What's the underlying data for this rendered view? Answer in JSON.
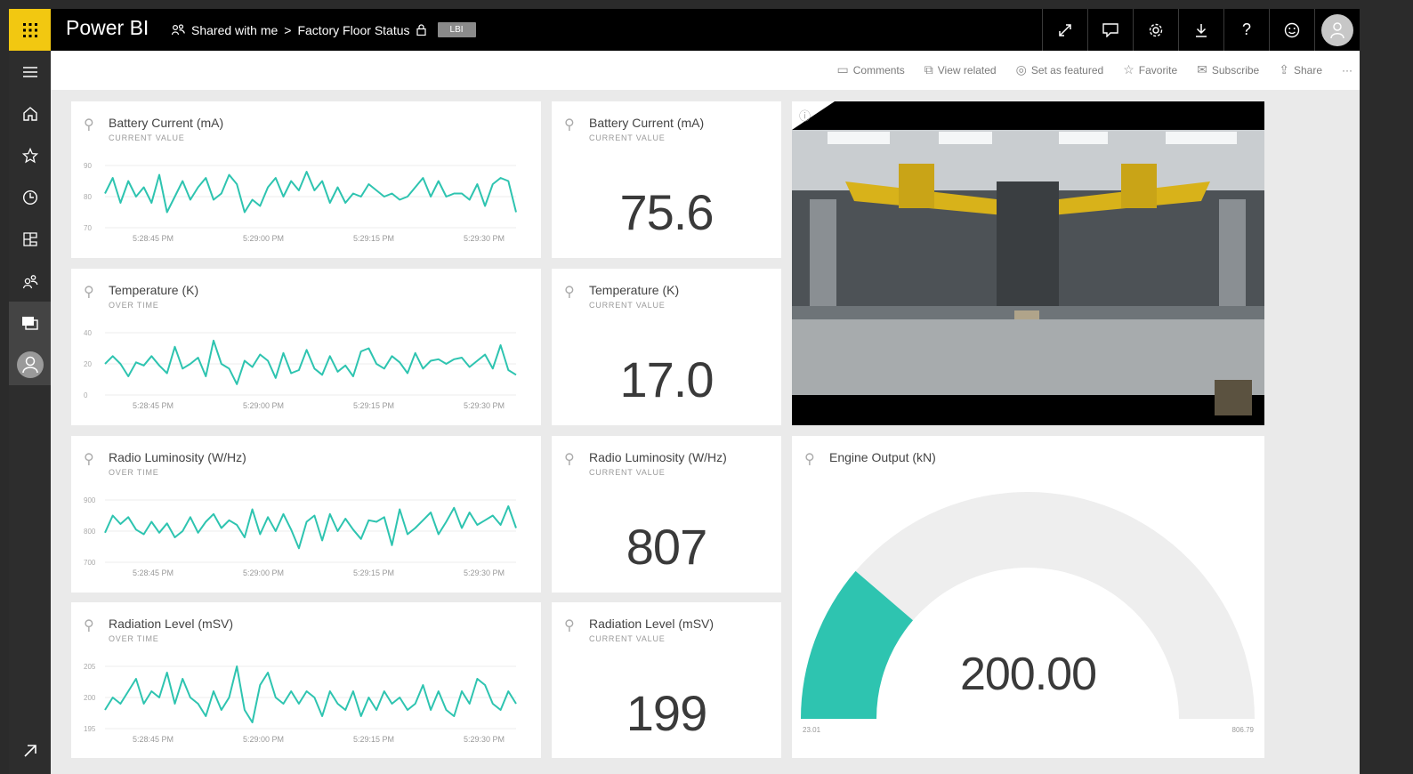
{
  "app": {
    "brand": "Power BI"
  },
  "breadcrumb": {
    "shared": "Shared with me",
    "separator": ">",
    "dashboard": "Factory Floor Status",
    "badge": "LBI"
  },
  "toolbar_icons": [
    "expand-icon",
    "comment-icon",
    "gear-icon",
    "download-icon",
    "help-icon",
    "smiley-icon",
    "user-avatar"
  ],
  "actions": [
    {
      "label": "Comments",
      "icon": "comment-icon"
    },
    {
      "label": "View related",
      "icon": "related-icon"
    },
    {
      "label": "Set as featured",
      "icon": "featured-icon"
    },
    {
      "label": "Favorite",
      "icon": "star-icon"
    },
    {
      "label": "Subscribe",
      "icon": "mail-icon"
    },
    {
      "label": "Share",
      "icon": "share-icon"
    },
    {
      "label": "···",
      "icon": "more-icon"
    }
  ],
  "nav": [
    "menu-icon",
    "home-icon",
    "star-icon",
    "clock-icon",
    "apps-icon",
    "shared-icon",
    "workspaces-icon",
    "avatar",
    "expand-icon"
  ],
  "accent": "#2ec4b0",
  "tiles": {
    "battery_line": {
      "title": "Battery Current (mA)",
      "subtitle": "CURRENT VALUE"
    },
    "battery_card": {
      "title": "Battery Current (mA)",
      "subtitle": "CURRENT VALUE",
      "value": "75.6"
    },
    "temp_line": {
      "title": "Temperature (K)",
      "subtitle": "OVER TIME"
    },
    "temp_card": {
      "title": "Temperature (K)",
      "subtitle": "CURRENT VALUE",
      "value": "17.0"
    },
    "radio_line": {
      "title": "Radio Luminosity (W/Hz)",
      "subtitle": "OVER TIME"
    },
    "radio_card": {
      "title": "Radio Luminosity (W/Hz)",
      "subtitle": "CURRENT VALUE",
      "value": "807"
    },
    "radiation_line": {
      "title": "Radiation Level (mSV)",
      "subtitle": "OVER TIME"
    },
    "radiation_card": {
      "title": "Radiation Level (mSV)",
      "subtitle": "CURRENT VALUE",
      "value": "199"
    },
    "gauge": {
      "title": "Engine Output (kN)",
      "value": "200.00",
      "min_label": "23.01",
      "max_label": "806.79"
    }
  },
  "chart_data": [
    {
      "type": "line",
      "name": "battery",
      "ylim": [
        70,
        90
      ],
      "yticks": [
        "90",
        "80",
        "70"
      ],
      "xticks": [
        "5:28:45 PM",
        "5:29:00 PM",
        "5:29:15 PM",
        "5:29:30 PM"
      ],
      "values": [
        81,
        86,
        78,
        85,
        80,
        83,
        78,
        87,
        75,
        80,
        85,
        79,
        83,
        86,
        79,
        81,
        87,
        84,
        75,
        79,
        77,
        83,
        86,
        80,
        85,
        82,
        88,
        82,
        85,
        78,
        83,
        78,
        81,
        80,
        84,
        82,
        80,
        81,
        79,
        80,
        83,
        86,
        80,
        85,
        80,
        81,
        81,
        79,
        84,
        77,
        84,
        86,
        85,
        75
      ]
    },
    {
      "type": "line",
      "name": "temperature",
      "ylim": [
        0,
        40
      ],
      "yticks": [
        "40",
        "20",
        "0"
      ],
      "xticks": [
        "5:28:45 PM",
        "5:29:00 PM",
        "5:29:15 PM",
        "5:29:30 PM"
      ],
      "values": [
        20,
        25,
        20,
        12,
        21,
        19,
        25,
        19,
        14,
        31,
        17,
        20,
        24,
        12,
        35,
        20,
        17,
        7,
        22,
        18,
        26,
        22,
        11,
        27,
        14,
        16,
        29,
        17,
        13,
        25,
        15,
        19,
        12,
        28,
        30,
        20,
        17,
        25,
        21,
        14,
        27,
        17,
        22,
        23,
        20,
        23,
        24,
        18,
        22,
        26,
        17,
        32,
        16,
        13
      ]
    },
    {
      "type": "line",
      "name": "radio",
      "ylim": [
        700,
        900
      ],
      "yticks": [
        "900",
        "800",
        "700"
      ],
      "xticks": [
        "5:28:45 PM",
        "5:29:00 PM",
        "5:29:15 PM",
        "5:29:30 PM"
      ],
      "values": [
        795,
        850,
        823,
        845,
        805,
        790,
        830,
        795,
        825,
        780,
        800,
        845,
        795,
        830,
        855,
        810,
        835,
        820,
        780,
        870,
        790,
        845,
        800,
        855,
        805,
        745,
        830,
        850,
        770,
        855,
        800,
        840,
        805,
        775,
        835,
        830,
        845,
        755,
        870,
        790,
        810,
        835,
        860,
        790,
        830,
        875,
        810,
        860,
        820,
        835,
        850,
        820,
        880,
        810
      ]
    },
    {
      "type": "line",
      "name": "radiation",
      "ylim": [
        195,
        205
      ],
      "yticks": [
        "205",
        "200",
        "195"
      ],
      "xticks": [
        "5:28:45 PM",
        "5:29:00 PM",
        "5:29:15 PM",
        "5:29:30 PM"
      ],
      "values": [
        198,
        200,
        199,
        201,
        203,
        199,
        201,
        200,
        204,
        199,
        203,
        200,
        199,
        197,
        201,
        198,
        200,
        205,
        198,
        196,
        202,
        204,
        200,
        199,
        201,
        199,
        201,
        200,
        197,
        201,
        199,
        198,
        201,
        197,
        200,
        198,
        201,
        199,
        200,
        198,
        199,
        202,
        198,
        201,
        198,
        197,
        201,
        199,
        203,
        202,
        199,
        198,
        201,
        199
      ]
    },
    {
      "type": "gauge",
      "name": "engine",
      "value": 200.0,
      "min": 23.01,
      "max": 806.79
    }
  ]
}
